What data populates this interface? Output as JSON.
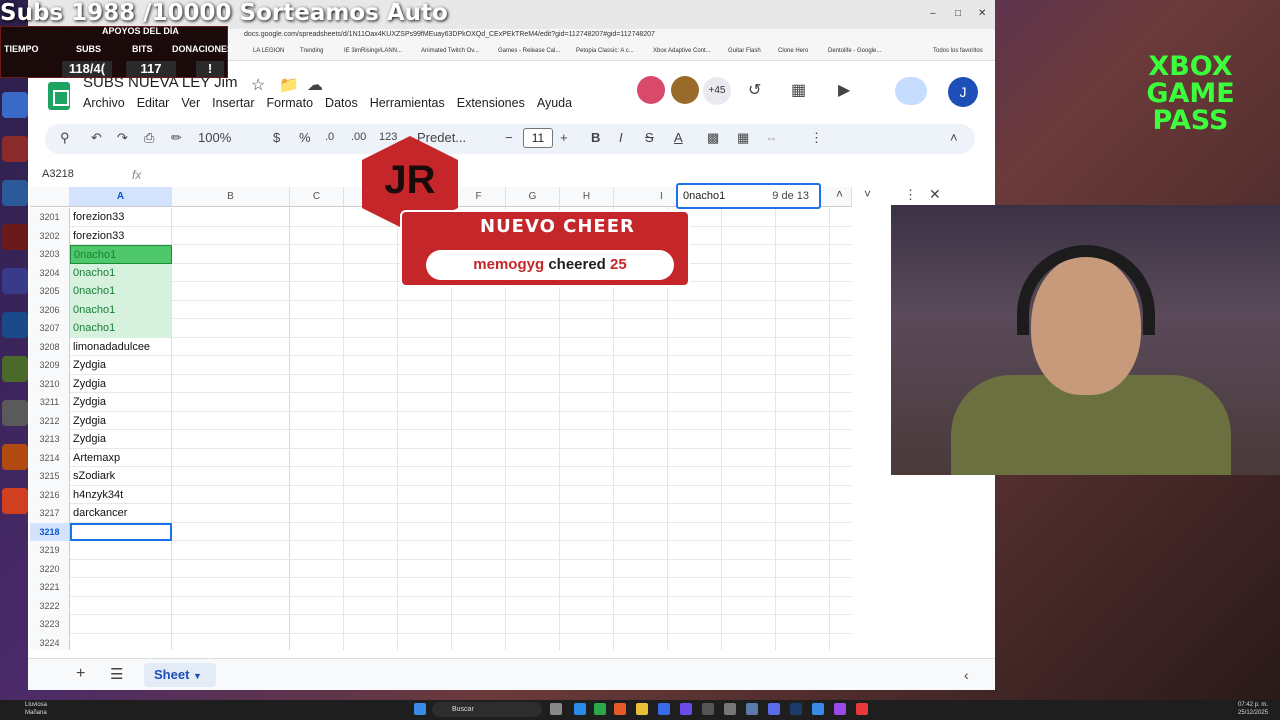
{
  "browser": {
    "url": "docs.google.com/spreadsheets/d/1N11Oax4KUXZSPs99fMEuay63DPkOXQd_CExPEkTReM4/edit?gid=112748207#gid=112748207",
    "bookmarks": [
      "LA LEGION",
      "Trending",
      "IE 3imRising#LANN...",
      "Animated Twitch Ov...",
      "Games - Release Cal...",
      "Petopia Classic: A c...",
      "Xbox Adaptive Cont...",
      "Guitar Flash",
      "Clone Hero",
      "Dentolife - Google...",
      "Todos los favoritos"
    ]
  },
  "sheets": {
    "doc_title": "SUBS NUEVA LEY Jim",
    "menu": [
      "Archivo",
      "Editar",
      "Ver",
      "Insertar",
      "Formato",
      "Datos",
      "Herramientas",
      "Extensiones",
      "Ayuda"
    ],
    "more_collaborators": "+45",
    "profile_initial": "J",
    "toolbar": {
      "zoom": "100%",
      "currency": "$",
      "percent": "%",
      "decrease_decimals": ".0",
      "increase_decimals": ".00",
      "number_format": "123",
      "font": "Predet...",
      "font_size": "11",
      "bold": "B",
      "italic": "I"
    },
    "namebox": "A3218",
    "fx": "fx",
    "columns": [
      "A",
      "B",
      "C",
      "D",
      "E",
      "F",
      "G",
      "H",
      "I"
    ],
    "rows": [
      {
        "num": "3201",
        "a": "forezion33"
      },
      {
        "num": "3202",
        "a": "forezion33"
      },
      {
        "num": "3203",
        "a": "0nacho1"
      },
      {
        "num": "3204",
        "a": "0nacho1"
      },
      {
        "num": "3205",
        "a": "0nacho1"
      },
      {
        "num": "3206",
        "a": "0nacho1"
      },
      {
        "num": "3207",
        "a": "0nacho1"
      },
      {
        "num": "3208",
        "a": "limonadadulcee"
      },
      {
        "num": "3209",
        "a": "Zydgia"
      },
      {
        "num": "3210",
        "a": "Zydgia"
      },
      {
        "num": "3211",
        "a": "Zydgia"
      },
      {
        "num": "3212",
        "a": "Zydgia"
      },
      {
        "num": "3213",
        "a": "Zydgia"
      },
      {
        "num": "3214",
        "a": "Artemaxp"
      },
      {
        "num": "3215",
        "a": "sZodiark"
      },
      {
        "num": "3216",
        "a": "h4nzyk34t"
      },
      {
        "num": "3217",
        "a": "darckancer"
      },
      {
        "num": "3218",
        "a": ""
      },
      {
        "num": "3219",
        "a": ""
      },
      {
        "num": "3220",
        "a": ""
      },
      {
        "num": "3221",
        "a": ""
      },
      {
        "num": "3222",
        "a": ""
      },
      {
        "num": "3223",
        "a": ""
      },
      {
        "num": "3224",
        "a": ""
      }
    ],
    "find": {
      "term": "0nacho1",
      "count": "9 de 13"
    },
    "sheet_tab": "Sheet"
  },
  "overlay": {
    "title": "Subs 1988 /10000 Sorteamos Auto",
    "support_label": "APOYOS DEL DÍA",
    "stats": [
      {
        "label": "TIEMPO",
        "value": ""
      },
      {
        "label": "SUBS",
        "value": "118/4("
      },
      {
        "label": "BITS",
        "value": "117"
      },
      {
        "label": "DONACIONES",
        "value": "!"
      }
    ],
    "cheer": {
      "badge": "JR",
      "title": "NUEVO CHEER",
      "user": "memogyg",
      "verb": "cheered",
      "amount": "25"
    },
    "xbox": "XBOX GAME PASS"
  },
  "taskbar": {
    "search": "Buscar",
    "weather": [
      "Lluviosa",
      "Mañana"
    ],
    "time": "07:42 p. m.",
    "date": "25/12/2025"
  },
  "colors": {
    "sheets_green": "#1ea362",
    "find_highlight": "#d6f1dd",
    "active_match": "#4fc86b",
    "cheer_red": "#c5262a"
  }
}
